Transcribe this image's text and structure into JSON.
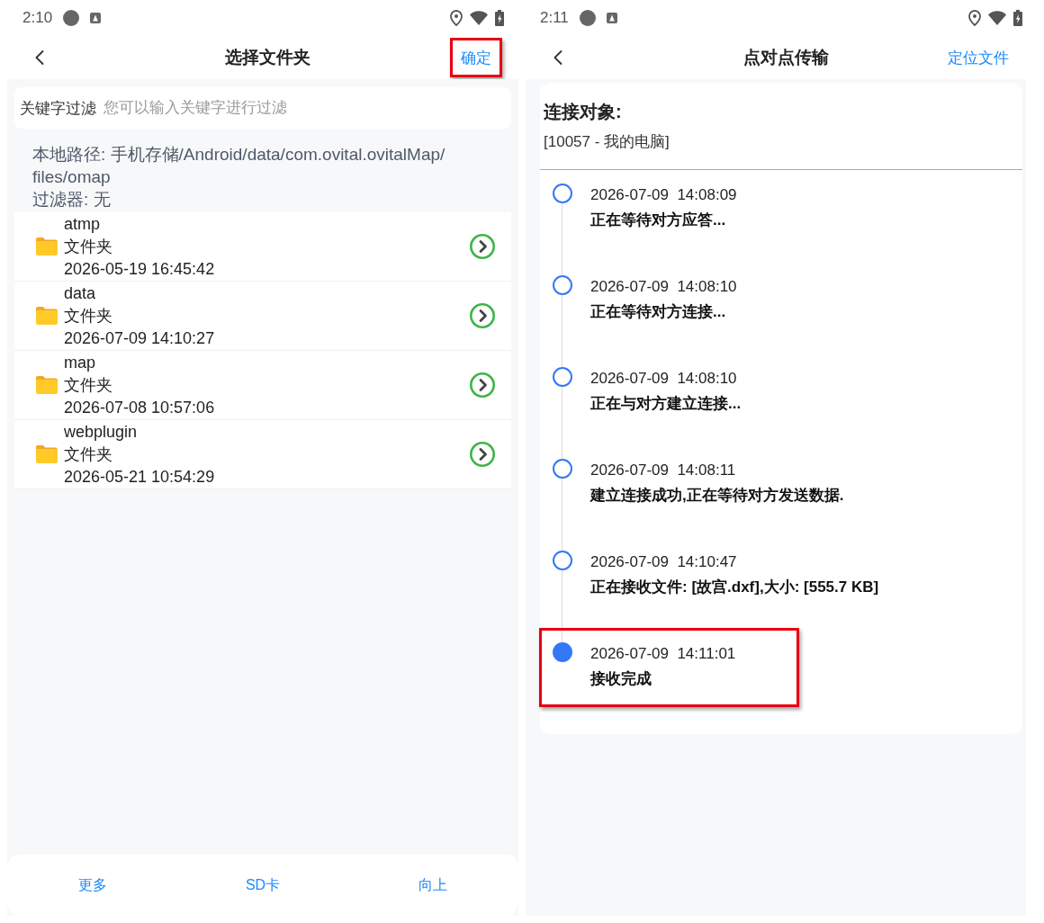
{
  "screens": [
    {
      "kind": "folder_picker",
      "status_bar": {
        "time": "2:10"
      },
      "header": {
        "title": "选择文件夹",
        "action": {
          "label": "确定",
          "highlighted": true
        }
      },
      "filter": {
        "label": "关键字过滤",
        "placeholder": "您可以输入关键字进行过滤"
      },
      "path_info": {
        "path": "本地路径: 手机存储/Android/data/com.ovital.ovitalMap/files/omap",
        "filter": "过滤器: 无"
      },
      "folders": [
        {
          "name": "atmp",
          "type": "文件夹",
          "modified": "2026-05-19 16:45:42"
        },
        {
          "name": "data",
          "type": "文件夹",
          "modified": "2026-07-09 14:10:27"
        },
        {
          "name": "map",
          "type": "文件夹",
          "modified": "2026-07-08 10:57:06"
        },
        {
          "name": "webplugin",
          "type": "文件夹",
          "modified": "2026-05-21 10:54:29"
        }
      ],
      "bottom_bar": [
        {
          "label": "更多"
        },
        {
          "label": "SD卡"
        },
        {
          "label": "向上"
        }
      ]
    },
    {
      "kind": "transfer_log",
      "status_bar": {
        "time": "2:11"
      },
      "header": {
        "title": "点对点传输",
        "action": {
          "label": "定位文件",
          "highlighted": false
        }
      },
      "connection": {
        "heading": "连接对象:",
        "peer": "[10057 - 我的电脑]"
      },
      "events": [
        {
          "timestamp": "2026-07-09  14:08:09",
          "message": "正在等待对方应答...",
          "current": false,
          "highlighted": false
        },
        {
          "timestamp": "2026-07-09  14:08:10",
          "message": "正在等待对方连接...",
          "current": false,
          "highlighted": false
        },
        {
          "timestamp": "2026-07-09  14:08:10",
          "message": "正在与对方建立连接...",
          "current": false,
          "highlighted": false
        },
        {
          "timestamp": "2026-07-09  14:08:11",
          "message": "建立连接成功,正在等待对方发送数据.",
          "current": false,
          "highlighted": false
        },
        {
          "timestamp": "2026-07-09  14:10:47",
          "message": "正在接收文件: [故宫.dxf],大小: [555.7 KB]",
          "current": false,
          "highlighted": false
        },
        {
          "timestamp": "2026-07-09  14:11:01",
          "message": "接收完成",
          "current": true,
          "highlighted": true
        }
      ]
    }
  ]
}
